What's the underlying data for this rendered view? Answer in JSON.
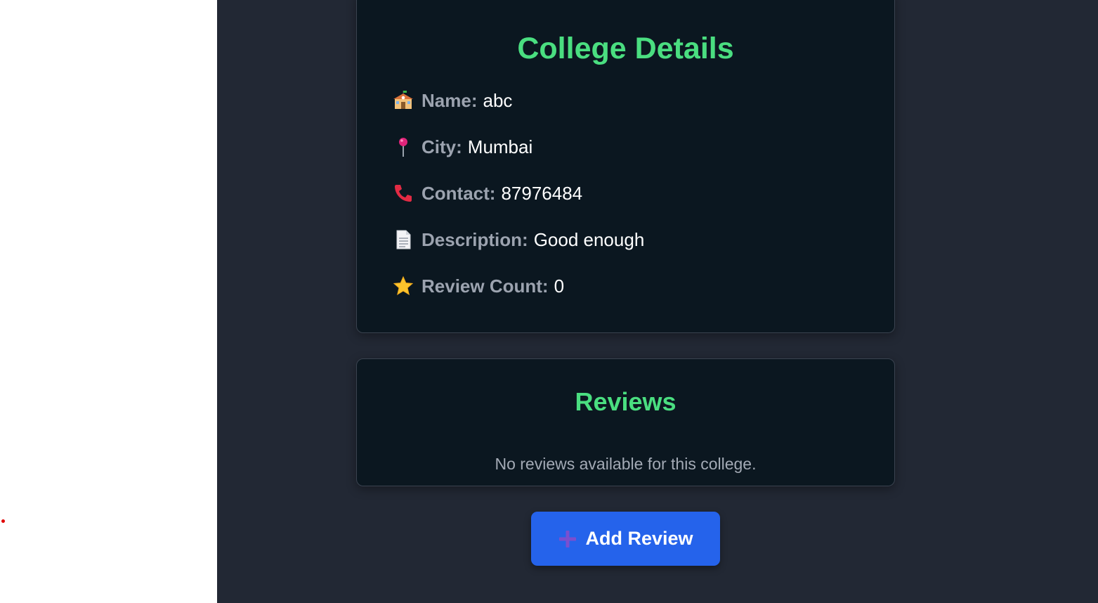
{
  "details": {
    "title": "College Details",
    "rows": [
      {
        "icon": "school-icon",
        "label": "Name:",
        "value": "abc"
      },
      {
        "icon": "pushpin-icon",
        "label": "City:",
        "value": "Mumbai"
      },
      {
        "icon": "telephone-icon",
        "label": "Contact:",
        "value": "87976484"
      },
      {
        "icon": "document-icon",
        "label": "Description:",
        "value": "Good enough"
      },
      {
        "icon": "star-icon",
        "label": "Review Count:",
        "value": "0"
      }
    ]
  },
  "reviews": {
    "title": "Reviews",
    "empty_message": "No reviews available for this college."
  },
  "actions": {
    "add_review_label": "Add Review",
    "add_review_icon": "plus-icon"
  },
  "colors": {
    "accent_green": "#4ade80",
    "button_blue": "#2563eb",
    "page_bg": "#222834",
    "card_bg": "#0b1720"
  }
}
